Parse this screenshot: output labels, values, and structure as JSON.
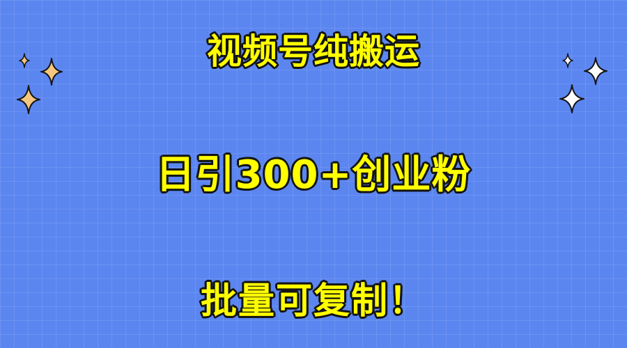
{
  "poster": {
    "title": "视频号纯搬运",
    "headline": "日引300+创业粉",
    "tagline": "批量可复制！"
  },
  "colors": {
    "background": "#5b86f0",
    "text_fill": "#ffff00",
    "text_outline": "#141414",
    "sparkle_gold": "#f5c77e",
    "sparkle_white": "#ffffff"
  },
  "icons": {
    "left_cluster": "sparkle-icon",
    "right_cluster": "sparkle-icon"
  }
}
